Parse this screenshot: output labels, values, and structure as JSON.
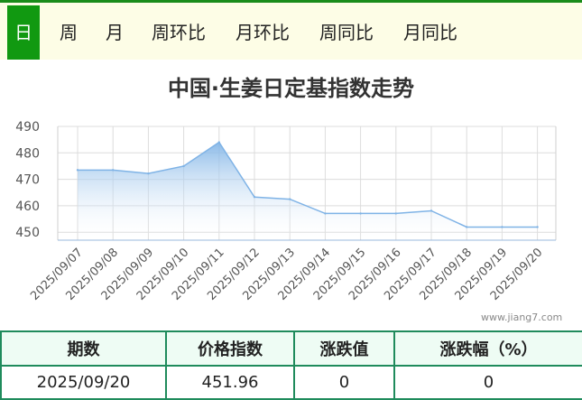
{
  "tabs": [
    {
      "label": "日",
      "active": true
    },
    {
      "label": "周",
      "active": false
    },
    {
      "label": "月",
      "active": false
    },
    {
      "label": "周环比",
      "active": false
    },
    {
      "label": "月环比",
      "active": false
    },
    {
      "label": "周同比",
      "active": false
    },
    {
      "label": "月同比",
      "active": false
    }
  ],
  "colors": {
    "tab_border": "#1a8c1a",
    "tab_active": "#119911",
    "line": "#7fb3e6",
    "area_top": "#7fb3e6",
    "area_bottom": "#ffffff",
    "table_border": "#1f8b5c",
    "table_header_bg": "#eefcf4"
  },
  "chart_data": {
    "type": "area",
    "title": "中国·生姜日定基指数走势",
    "x": [
      "2025/09/07",
      "2025/09/08",
      "2025/09/09",
      "2025/09/10",
      "2025/09/11",
      "2025/09/12",
      "2025/09/13",
      "2025/09/14",
      "2025/09/15",
      "2025/09/16",
      "2025/09/17",
      "2025/09/18",
      "2025/09/19",
      "2025/09/20"
    ],
    "values": [
      473.5,
      473.5,
      472.2,
      475,
      484,
      463.3,
      462.5,
      457.1,
      457.1,
      457.1,
      458.1,
      451.96,
      451.96,
      451.96
    ],
    "yticks": [
      450,
      460,
      470,
      480,
      490
    ],
    "ylim": [
      447,
      490
    ],
    "grid": true,
    "legend": "none"
  },
  "watermark": "www.jiang7.com",
  "table": {
    "headers": [
      "期数",
      "价格指数",
      "涨跌值",
      "涨跌幅（%）"
    ],
    "row": [
      "2025/09/20",
      "451.96",
      "0",
      "0"
    ]
  }
}
